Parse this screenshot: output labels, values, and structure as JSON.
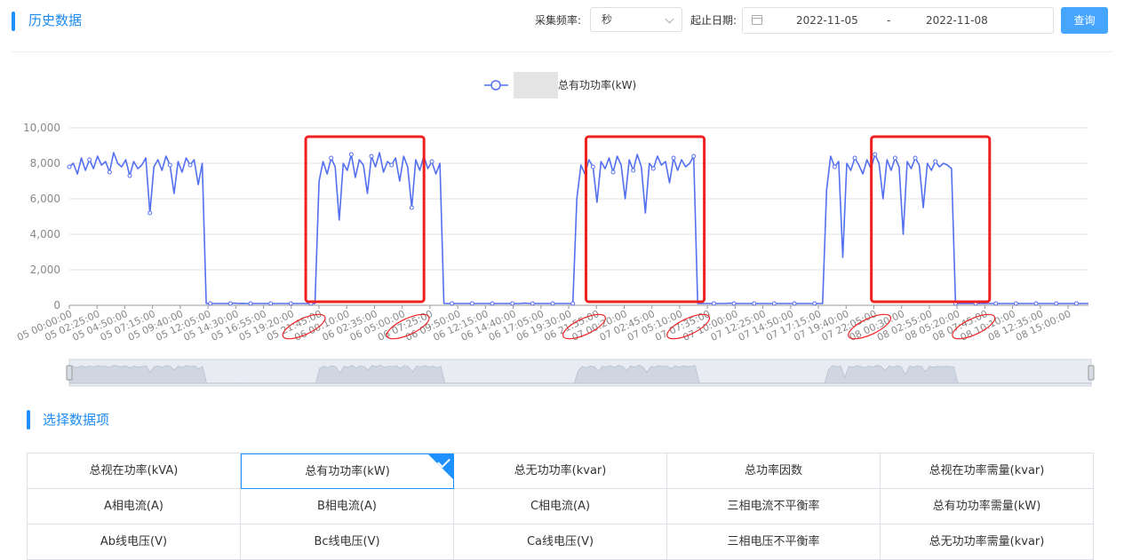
{
  "header": {
    "title": "历史数据"
  },
  "filters": {
    "freq_label": "采集频率:",
    "freq_value": "秒",
    "date_label": "起止日期:",
    "date_start": "2022-11-05",
    "date_sep": "-",
    "date_end": "2022-11-08",
    "query_button": "查询"
  },
  "section": {
    "title": "选择数据项"
  },
  "data_items": [
    [
      "总视在功率(kVA)",
      "总有功功率(kW)",
      "总无功功率(kvar)",
      "总功率因数",
      "总视在功率需量(kvar)"
    ],
    [
      "A相电流(A)",
      "B相电流(A)",
      "C相电流(A)",
      "三相电流不平衡率",
      "总有功功率需量(kW)"
    ],
    [
      "Ab线电压(V)",
      "Bc线电压(V)",
      "Ca线电压(V)",
      "三相电压不平衡率",
      "总无功功率需量(kvar)"
    ]
  ],
  "selected_item": "总有功功率(kW)",
  "colors": {
    "accent": "#1e90ff",
    "series": "#5470f0",
    "highlight": "#f02020"
  },
  "chart_data": {
    "type": "line",
    "series": [
      {
        "name": "总有功功率(kW)"
      }
    ],
    "ylim": [
      0,
      10000
    ],
    "yticks": [
      0,
      2000,
      4000,
      6000,
      8000,
      10000
    ],
    "ytick_labels": [
      "0",
      "2,000",
      "4,000",
      "6,000",
      "8,000",
      "10,000"
    ],
    "xtick_labels": [
      "05 00:00:00",
      "05 02:25:00",
      "05 04:50:00",
      "05 07:15:00",
      "05 09:40:00",
      "05 12:05:00",
      "05 14:30:00",
      "05 16:55:00",
      "05 19:20:00",
      "05 21:45:00",
      "06 00:10:00",
      "06 02:35:00",
      "06 05:00:00",
      "06 07:25:00",
      "06 09:50:00",
      "06 12:15:00",
      "06 14:40:00",
      "06 17:05:00",
      "06 19:30:00",
      "06 21:55:00",
      "07 00:20:00",
      "07 02:45:00",
      "07 05:10:00",
      "07 07:35:00",
      "07 10:00:00",
      "07 12:25:00",
      "07 14:50:00",
      "07 17:15:00",
      "07 19:40:00",
      "07 22:05:00",
      "08 00:30:00",
      "08 02:55:00",
      "08 05:20:00",
      "08 07:45:00",
      "08 10:10:00",
      "08 12:35:00",
      "08 15:00:00"
    ],
    "values": [
      7800,
      8000,
      7400,
      8300,
      7600,
      8200,
      7700,
      8400,
      7900,
      8100,
      7500,
      8600,
      8000,
      7800,
      8200,
      7300,
      8100,
      7700,
      7900,
      8300,
      5200,
      7800,
      8200,
      7600,
      8400,
      7900,
      6300,
      8100,
      7500,
      8300,
      7900,
      8200,
      6800,
      8000,
      100,
      100,
      100,
      100,
      100,
      100,
      100,
      120,
      100,
      110,
      100,
      100,
      100,
      100,
      100,
      100,
      100,
      100,
      100,
      100,
      100,
      100,
      100,
      100,
      100,
      100,
      100,
      100,
      7000,
      8100,
      7400,
      8300,
      7800,
      4800,
      8000,
      7600,
      8500,
      7200,
      8200,
      7900,
      6300,
      8400,
      7800,
      8600,
      7500,
      8100,
      7900,
      8300,
      7000,
      8400,
      7800,
      5500,
      8200,
      7600,
      8400,
      7700,
      8100,
      7400,
      8000,
      100,
      100,
      100,
      100,
      100,
      100,
      100,
      100,
      100,
      100,
      100,
      100,
      100,
      100,
      100,
      100,
      100,
      100,
      100,
      100,
      120,
      100,
      100,
      100,
      100,
      100,
      100,
      100,
      100,
      100,
      100,
      100,
      100,
      6000,
      7900,
      7400,
      8200,
      7800,
      5800,
      8100,
      7700,
      8300,
      7500,
      8400,
      7900,
      6000,
      8200,
      7600,
      8500,
      7800,
      5200,
      8000,
      7700,
      8400,
      7900,
      8100,
      6900,
      8300,
      7600,
      8200,
      7800,
      8000,
      8400,
      100,
      100,
      100,
      100,
      100,
      100,
      100,
      100,
      120,
      100,
      100,
      100,
      100,
      100,
      100,
      100,
      100,
      100,
      100,
      100,
      100,
      100,
      100,
      100,
      100,
      100,
      100,
      100,
      100,
      100,
      100,
      100,
      6500,
      8400,
      7800,
      8100,
      2700,
      8000,
      7600,
      8300,
      7900,
      7400,
      8200,
      7700,
      8500,
      8000,
      6000,
      8200,
      7600,
      8300,
      7800,
      4000,
      8100,
      7700,
      8300,
      7900,
      5500,
      8000,
      7600,
      8100,
      7800,
      8000,
      7900,
      7700,
      100,
      100,
      100,
      100,
      100,
      100,
      100,
      100,
      100,
      100,
      100,
      100,
      100,
      100,
      100,
      100,
      100,
      100,
      100,
      100,
      100,
      100,
      100,
      100,
      100,
      100,
      100,
      100,
      100,
      100,
      100,
      100,
      100,
      100
    ]
  }
}
